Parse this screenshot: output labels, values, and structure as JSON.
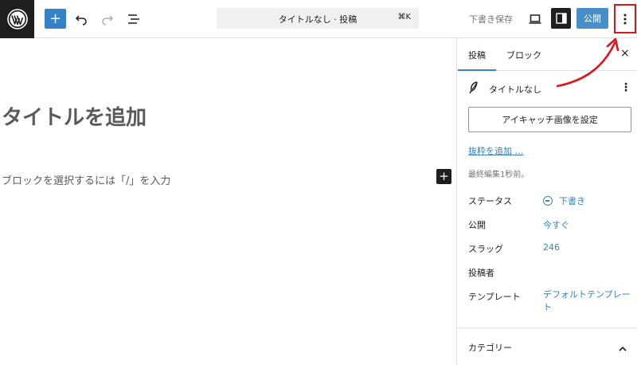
{
  "toolbar": {
    "logo_icon": "wordpress-logo-icon",
    "add_block_label": "+",
    "command_bar_title": "タイトルなし · 投稿",
    "command_bar_shortcut": "⌘K",
    "save_draft_label": "下書き保存",
    "publish_label": "公開",
    "options_icon": "kebab-menu-icon"
  },
  "editor": {
    "title_placeholder": "タイトルを追加",
    "block_placeholder": "ブロックを選択するには「/」を入力",
    "inserter_label": "+"
  },
  "sidebar": {
    "tabs": [
      {
        "label": "投稿"
      },
      {
        "label": "ブロック"
      }
    ],
    "close_label": "×",
    "post_title": "タイトルなし",
    "more_label": "⋮",
    "featured_image_label": "アイキャッチ画像を設定",
    "excerpt_link": "抜粋を追加 …",
    "last_edited": "最終編集1秒前。",
    "meta": [
      {
        "label": "ステータス",
        "value": "下書き"
      },
      {
        "label": "公開",
        "value": "今すぐ"
      },
      {
        "label": "スラッグ",
        "value": "246"
      },
      {
        "label": "投稿者",
        "value": ""
      },
      {
        "label": "テンプレート",
        "value": "デフォルトテンプレート"
      }
    ],
    "category_label": "カテゴリー"
  },
  "colors": {
    "accent": "#3582c4",
    "annotation": "#e0131a",
    "dark": "#1e1e1e"
  }
}
